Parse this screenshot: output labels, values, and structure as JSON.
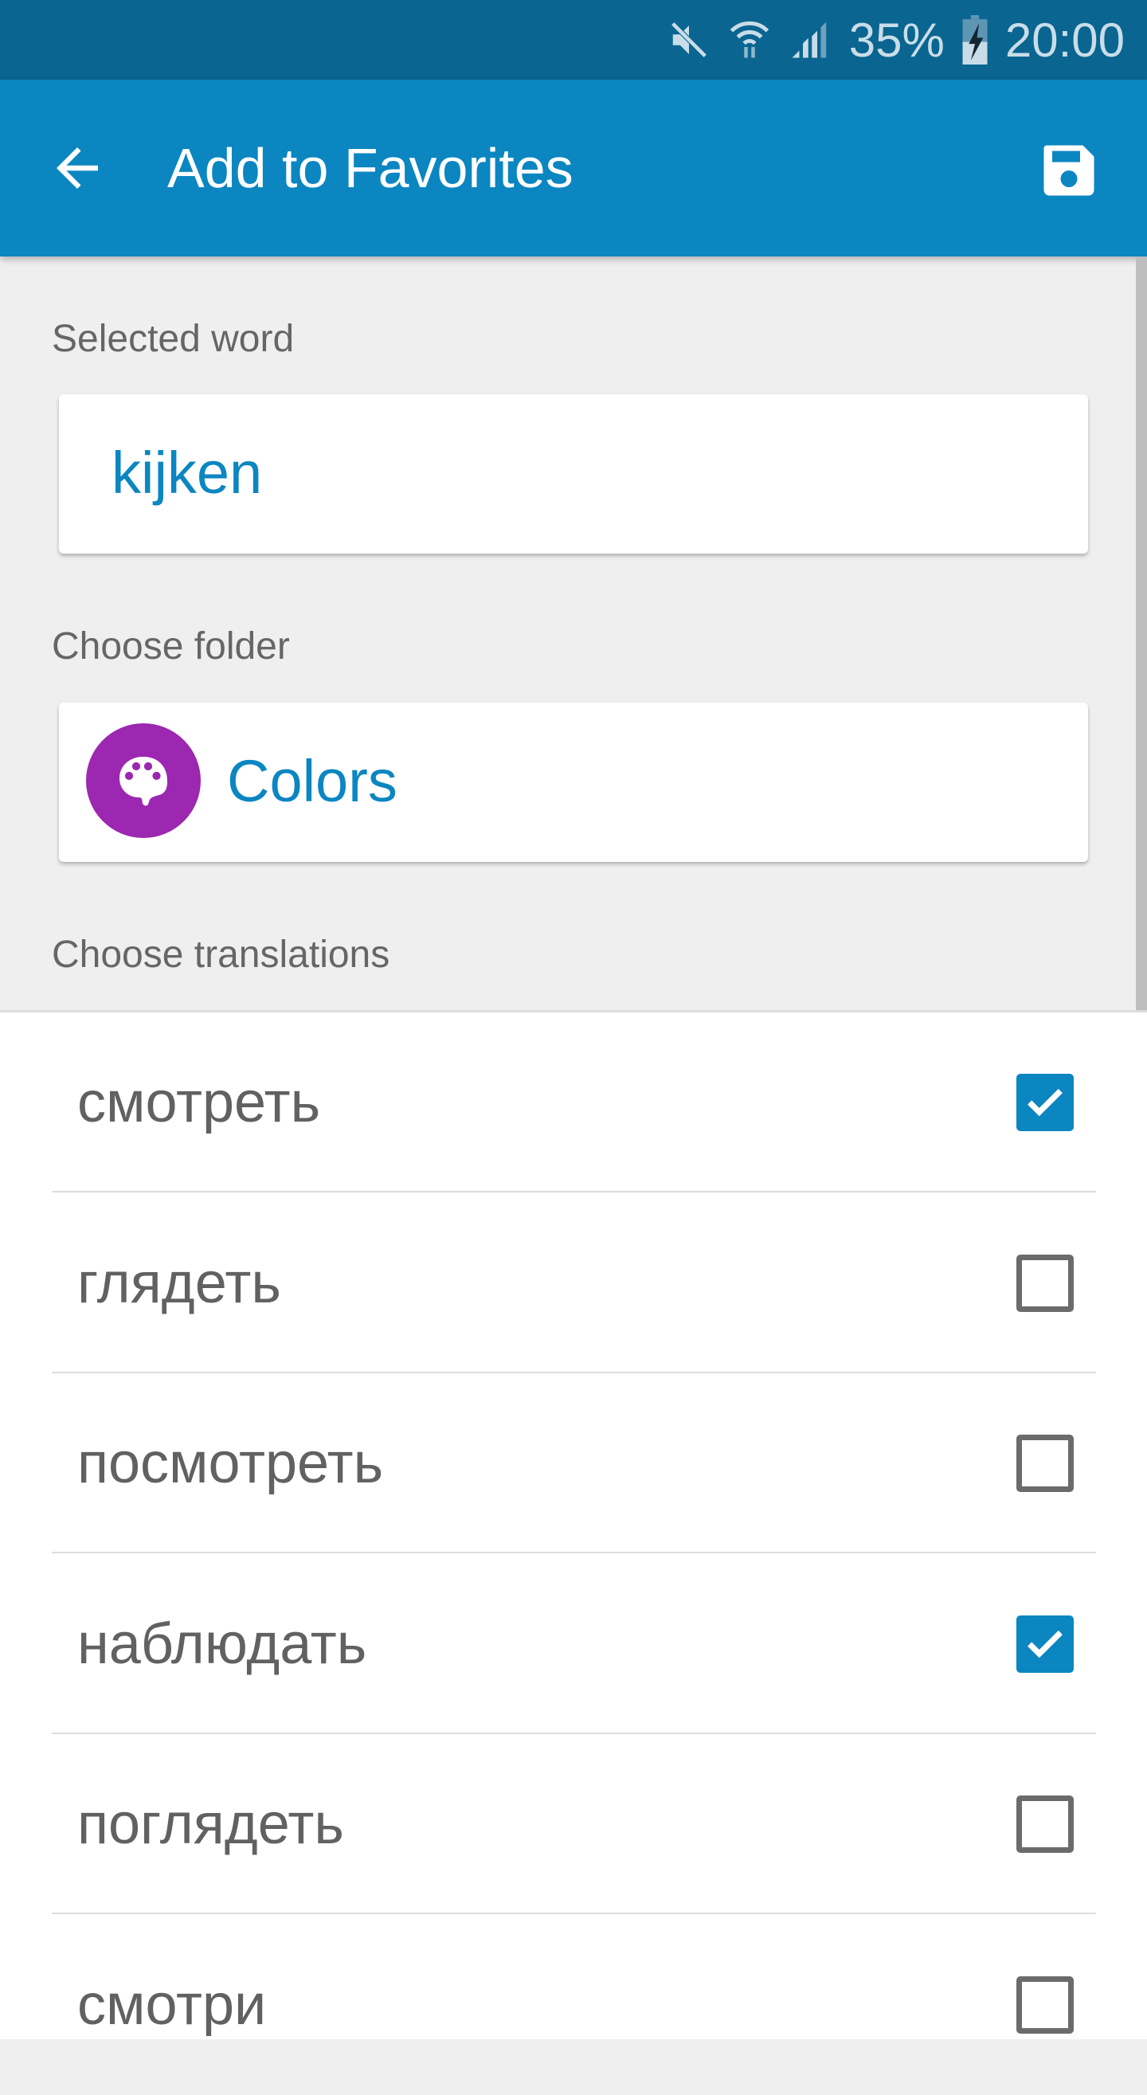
{
  "status_bar": {
    "battery": "35%",
    "time": "20:00",
    "icons": [
      "mute-icon",
      "wifi-icon",
      "signal-icon",
      "battery-charging-icon"
    ]
  },
  "app_bar": {
    "title": "Add to Favorites",
    "back_icon": "arrow-back-icon",
    "save_icon": "save-icon"
  },
  "selected_word": {
    "label": "Selected word",
    "value": "kijken"
  },
  "folder": {
    "label": "Choose folder",
    "name": "Colors",
    "icon": "palette-icon",
    "icon_color": "#9c27b0"
  },
  "translations": {
    "label": "Choose translations",
    "items": [
      {
        "text": "смотреть",
        "checked": true
      },
      {
        "text": "глядеть",
        "checked": false
      },
      {
        "text": "посмотреть",
        "checked": false
      },
      {
        "text": "наблюдать",
        "checked": true
      },
      {
        "text": "поглядеть",
        "checked": false
      },
      {
        "text": "смотри",
        "checked": false
      }
    ]
  },
  "colors": {
    "accent": "#0b86c1",
    "status_bar": "#0a6590"
  }
}
